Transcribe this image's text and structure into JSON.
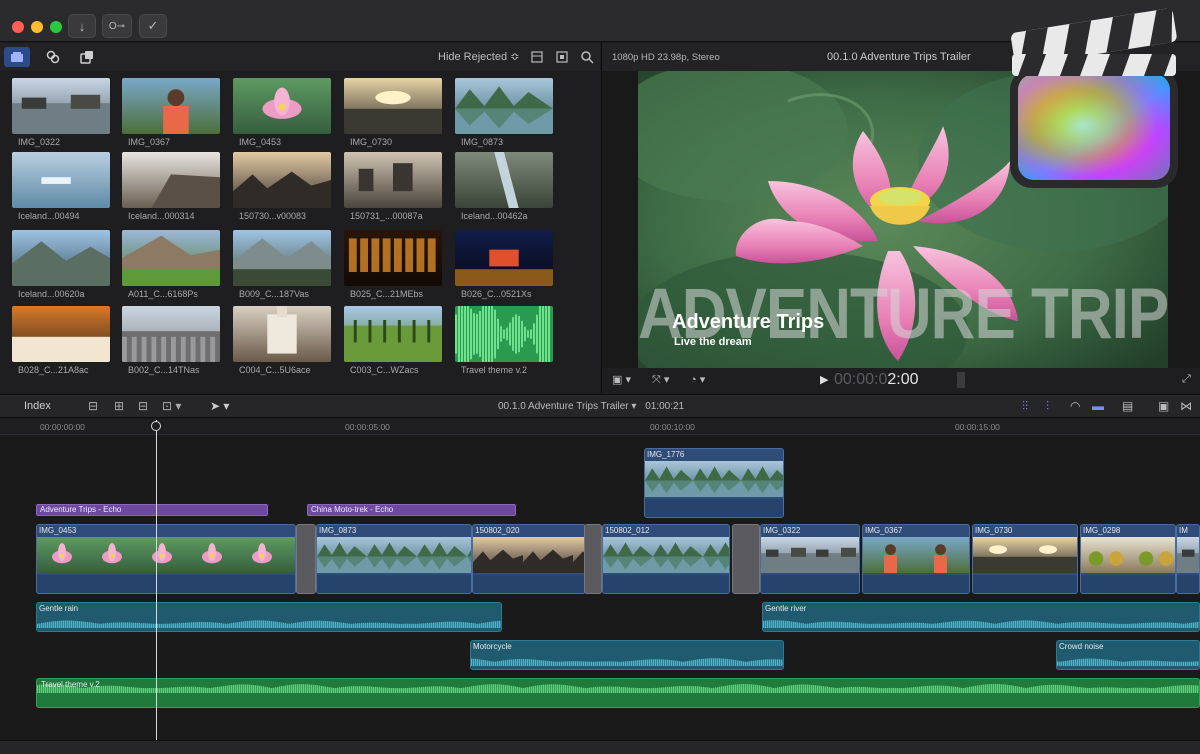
{
  "toolbar": {
    "import_icon": "↓",
    "keywords_icon": "O⊸",
    "background_tasks_icon": "✓"
  },
  "browser": {
    "hide_rejected": "Hide Rejected ≎",
    "clips": [
      {
        "label": "IMG_0322",
        "scene": "river"
      },
      {
        "label": "IMG_0367",
        "scene": "person"
      },
      {
        "label": "IMG_0453",
        "scene": "lotus"
      },
      {
        "label": "IMG_0730",
        "scene": "sunset"
      },
      {
        "label": "IMG_0873",
        "scene": "karst"
      },
      {
        "label": "Iceland...00494",
        "scene": "ice"
      },
      {
        "label": "Iceland...000314",
        "scene": "cliff"
      },
      {
        "label": "150730...v00083",
        "scene": "rocks"
      },
      {
        "label": "150731_...00087a",
        "scene": "rocks2"
      },
      {
        "label": "Iceland...00462a",
        "scene": "gorge"
      },
      {
        "label": "Iceland...00620a",
        "scene": "mountain"
      },
      {
        "label": "A011_C...6168Ps",
        "scene": "meadow"
      },
      {
        "label": "B009_C...187Vas",
        "scene": "town"
      },
      {
        "label": "B025_C...21MEbs",
        "scene": "lights"
      },
      {
        "label": "B026_C...0521Xs",
        "scene": "tunnel"
      },
      {
        "label": "B028_C...21A8ac",
        "scene": "arch"
      },
      {
        "label": "B002_C...14TNas",
        "scene": "plaza"
      },
      {
        "label": "C004_C...5U6ace",
        "scene": "church"
      },
      {
        "label": "C003_C...WZacs",
        "scene": "vineyard"
      },
      {
        "label": "Travel theme v.2",
        "scene": "audio"
      }
    ]
  },
  "viewer": {
    "format": "1080p HD 23.98p, Stereo",
    "project_title": "00.1.0 Adventure Trips Trailer",
    "big_title": "ADVENTURE TRIPS",
    "overlay_title": "Adventure Trips",
    "overlay_subtitle": "Live the dream",
    "timecode_dim": "00:00:0",
    "timecode_bright": "2:00"
  },
  "timeline_header": {
    "index_label": "Index",
    "project_label": "00.1.0 Adventure Trips Trailer ▾",
    "duration": "01:00:21",
    "ruler": [
      "00:00:00:00",
      "00:00:05:00",
      "00:00:10:00",
      "00:00:15:00"
    ]
  },
  "timeline": {
    "connected_clip": "IMG_1776",
    "titles": [
      "Adventure Trips - Echo",
      "China Moto-trek - Echo"
    ],
    "primary_clips": [
      {
        "label": "IMG_0453",
        "scene": "lotus"
      },
      {
        "label": "IMG_0873",
        "scene": "karst"
      },
      {
        "label": "150802_020",
        "scene": "rocks"
      },
      {
        "label": "150802_012",
        "scene": "karst"
      },
      {
        "label": "IMG_0322",
        "scene": "river"
      },
      {
        "label": "IMG_0367",
        "scene": "person"
      },
      {
        "label": "IMG_0730",
        "scene": "sunset"
      },
      {
        "label": "IMG_0298",
        "scene": "market"
      },
      {
        "label": "IM",
        "scene": "river"
      }
    ],
    "audio_clips": [
      "Gentle rain",
      "Gentle river",
      "Motorcycle",
      "Crowd noise"
    ],
    "music_clip": "Travel theme v.2"
  },
  "colors": {
    "video_clip": "#2f4d78",
    "audio_clip": "#1f5a6e",
    "music_clip": "#1f7a3c",
    "title_clip": "#6e4a9e",
    "accent_blue": "#5a7cff"
  }
}
